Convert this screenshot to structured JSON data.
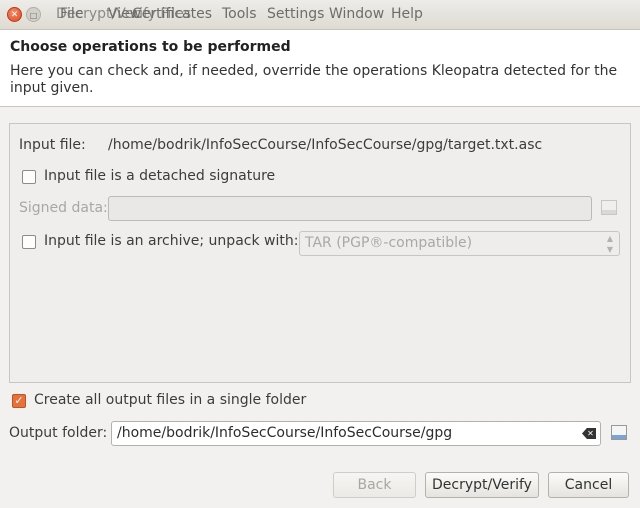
{
  "window": {
    "title": "Decrypt/Verify Files",
    "menu": [
      "File",
      "View",
      "Certificates",
      "Tools",
      "Settings",
      "Window",
      "Help"
    ]
  },
  "header": {
    "title": "Choose operations to be performed",
    "description": "Here you can check and, if needed, override the operations Kleopatra detected for the input given."
  },
  "operations": {
    "input_file_label": "Input file:",
    "input_file_path": "/home/bodrik/InfoSecCourse/InfoSecCourse/gpg/target.txt.asc",
    "detached_signature_label": "Input file is a detached signature",
    "detached_signature_checked": false,
    "signed_data_label": "Signed data:",
    "signed_data_value": "",
    "archive_label": "Input file is an archive; unpack with:",
    "archive_checked": false,
    "archive_format": "TAR (PGP®-compatible)"
  },
  "output": {
    "single_folder_label": "Create all output files in a single folder",
    "single_folder_checked": true,
    "folder_label": "Output folder:",
    "folder_value": "/home/bodrik/InfoSecCourse/InfoSecCourse/gpg"
  },
  "buttons": {
    "back": "Back",
    "decrypt_verify": "Decrypt/Verify",
    "cancel": "Cancel"
  },
  "icons": {
    "close": "close-icon",
    "minimize": "minimize-icon",
    "file_browse": "folder-open-icon",
    "clear": "clear-text-icon",
    "combo_arrow": "spin-arrows-icon"
  }
}
